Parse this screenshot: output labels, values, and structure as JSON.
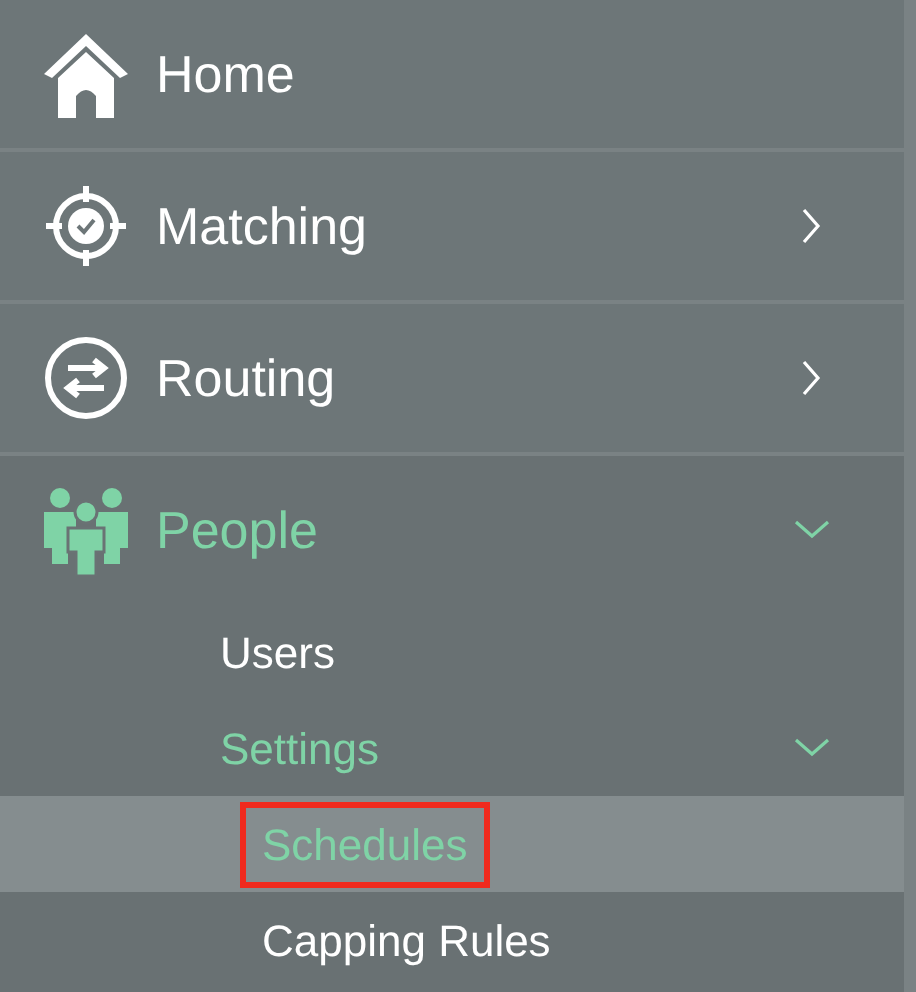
{
  "menu": [
    {
      "label": "Home",
      "kind": "home",
      "active": false
    },
    {
      "label": "Matching",
      "kind": "target",
      "active": false,
      "expanded": false
    },
    {
      "label": "Routing",
      "kind": "arrows",
      "active": false,
      "expanded": false
    },
    {
      "label": "People",
      "kind": "people",
      "active": true,
      "expanded": true,
      "children": [
        {
          "label": "Users",
          "active": false,
          "selected": false
        },
        {
          "label": "Settings",
          "active": true,
          "selected": false,
          "expanded": true,
          "children": [
            {
              "label": "Schedules",
              "active": true,
              "selected": true,
              "highlighted": true
            },
            {
              "label": "Capping Rules",
              "active": false,
              "selected": false,
              "highlighted": false
            }
          ]
        }
      ]
    }
  ]
}
